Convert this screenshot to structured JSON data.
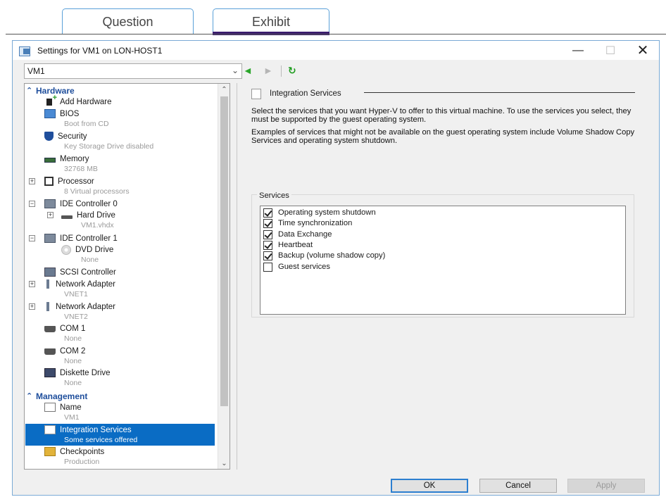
{
  "tabs": [
    {
      "label": "Question"
    },
    {
      "label": "Exhibit"
    }
  ],
  "window": {
    "title": "Settings for VM1 on LON-HOST1",
    "minimize_icon": "minimize-icon",
    "maximize_icon": "maximize-icon",
    "close_label": "✕"
  },
  "vm_select": {
    "value": "VM1"
  },
  "toolbar": {
    "back": "◄",
    "forward": "►",
    "refresh": "↻"
  },
  "tree": {
    "hardware_section": "Hardware",
    "management_section": "Management",
    "items": [
      {
        "label": "Add Hardware",
        "sub": ""
      },
      {
        "label": "BIOS",
        "sub": "Boot from CD"
      },
      {
        "label": "Security",
        "sub": "Key Storage Drive disabled"
      },
      {
        "label": "Memory",
        "sub": "32768 MB"
      },
      {
        "label": "Processor",
        "sub": "8 Virtual processors"
      },
      {
        "label": "IDE Controller 0",
        "sub": ""
      },
      {
        "label": "Hard Drive",
        "sub": "VM1.vhdx"
      },
      {
        "label": "IDE Controller 1",
        "sub": ""
      },
      {
        "label": "DVD Drive",
        "sub": "None"
      },
      {
        "label": "SCSI Controller",
        "sub": ""
      },
      {
        "label": "Network Adapter",
        "sub": "VNET1"
      },
      {
        "label": "Network Adapter",
        "sub": "VNET2"
      },
      {
        "label": "COM 1",
        "sub": "None"
      },
      {
        "label": "COM 2",
        "sub": "None"
      },
      {
        "label": "Diskette Drive",
        "sub": "None"
      },
      {
        "label": "Name",
        "sub": "VM1"
      },
      {
        "label": "Integration Services",
        "sub": "Some services offered"
      },
      {
        "label": "Checkpoints",
        "sub": "Production"
      }
    ]
  },
  "panel": {
    "title": "Integration Services",
    "desc1": "Select the services that you want Hyper-V to offer to this virtual machine. To use the services you select, they must be supported by the guest operating system.",
    "desc2": "Examples of services that might not be available on the guest operating system include Volume Shadow Copy Services and operating system shutdown.",
    "services_label": "Services",
    "services": [
      {
        "label": "Operating system shutdown",
        "checked": true
      },
      {
        "label": "Time synchronization",
        "checked": true
      },
      {
        "label": "Data Exchange",
        "checked": true
      },
      {
        "label": "Heartbeat",
        "checked": true
      },
      {
        "label": "Backup (volume shadow copy)",
        "checked": true
      },
      {
        "label": "Guest services",
        "checked": false
      }
    ]
  },
  "buttons": {
    "ok": "OK",
    "cancel": "Cancel",
    "apply": "Apply"
  },
  "colors": {
    "selection": "#0a6cc4",
    "section_heading": "#1e4e9c"
  }
}
